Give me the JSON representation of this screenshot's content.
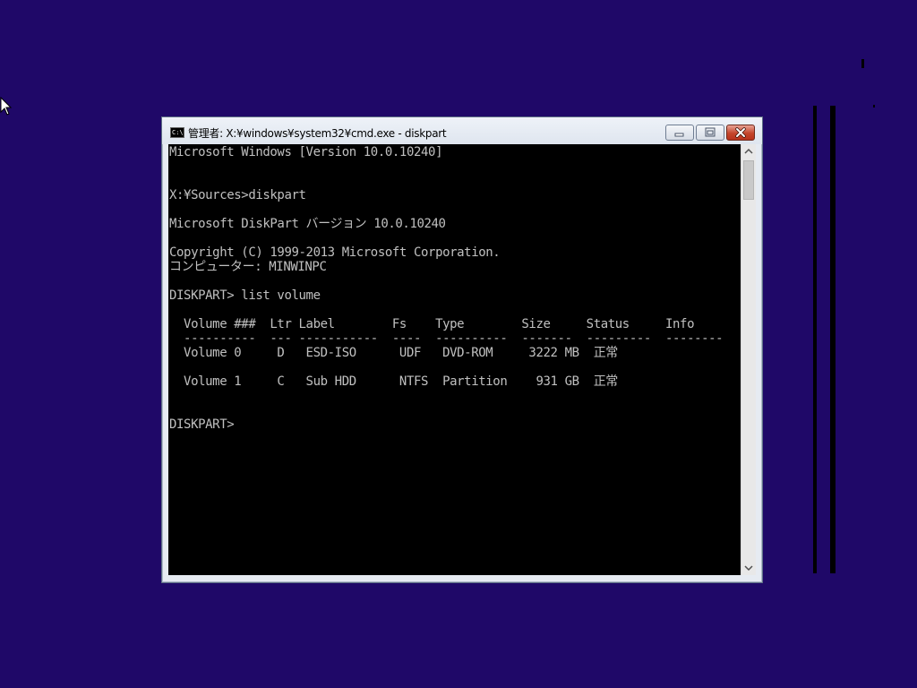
{
  "window": {
    "title": "管理者: X:¥windows¥system32¥cmd.exe - diskpart",
    "icon_text": "C:\\",
    "icon": "console-icon"
  },
  "titlebar_buttons": {
    "minimize": "minimize-icon",
    "maximize": "restore-icon",
    "close": "close-icon"
  },
  "console": {
    "lines": [
      "Microsoft Windows [Version 10.0.10240]",
      "",
      "",
      "X:¥Sources>diskpart",
      "",
      "Microsoft DiskPart バージョン 10.0.10240",
      "",
      "Copyright (C) 1999-2013 Microsoft Corporation.",
      "コンピューター: MINWINPC",
      "",
      "DISKPART> list volume",
      "",
      "  Volume ###  Ltr Label        Fs    Type        Size     Status     Info",
      "  ----------  --- -----------  ----  ----------  -------  ---------  --------",
      "  Volume 0     D   ESD-ISO      UDF   DVD-ROM     3222 MB  正常",
      "",
      "  Volume 1     C   Sub HDD      NTFS  Partition    931 GB  正常",
      "",
      "",
      "DISKPART>"
    ]
  },
  "scrollbar": {
    "up_arrow": "^",
    "down_arrow": "v"
  },
  "colors": {
    "desktop": "#1f0868",
    "console_bg": "#000000",
    "console_fg": "#c0c0c0",
    "close_button": "#c4462c"
  }
}
